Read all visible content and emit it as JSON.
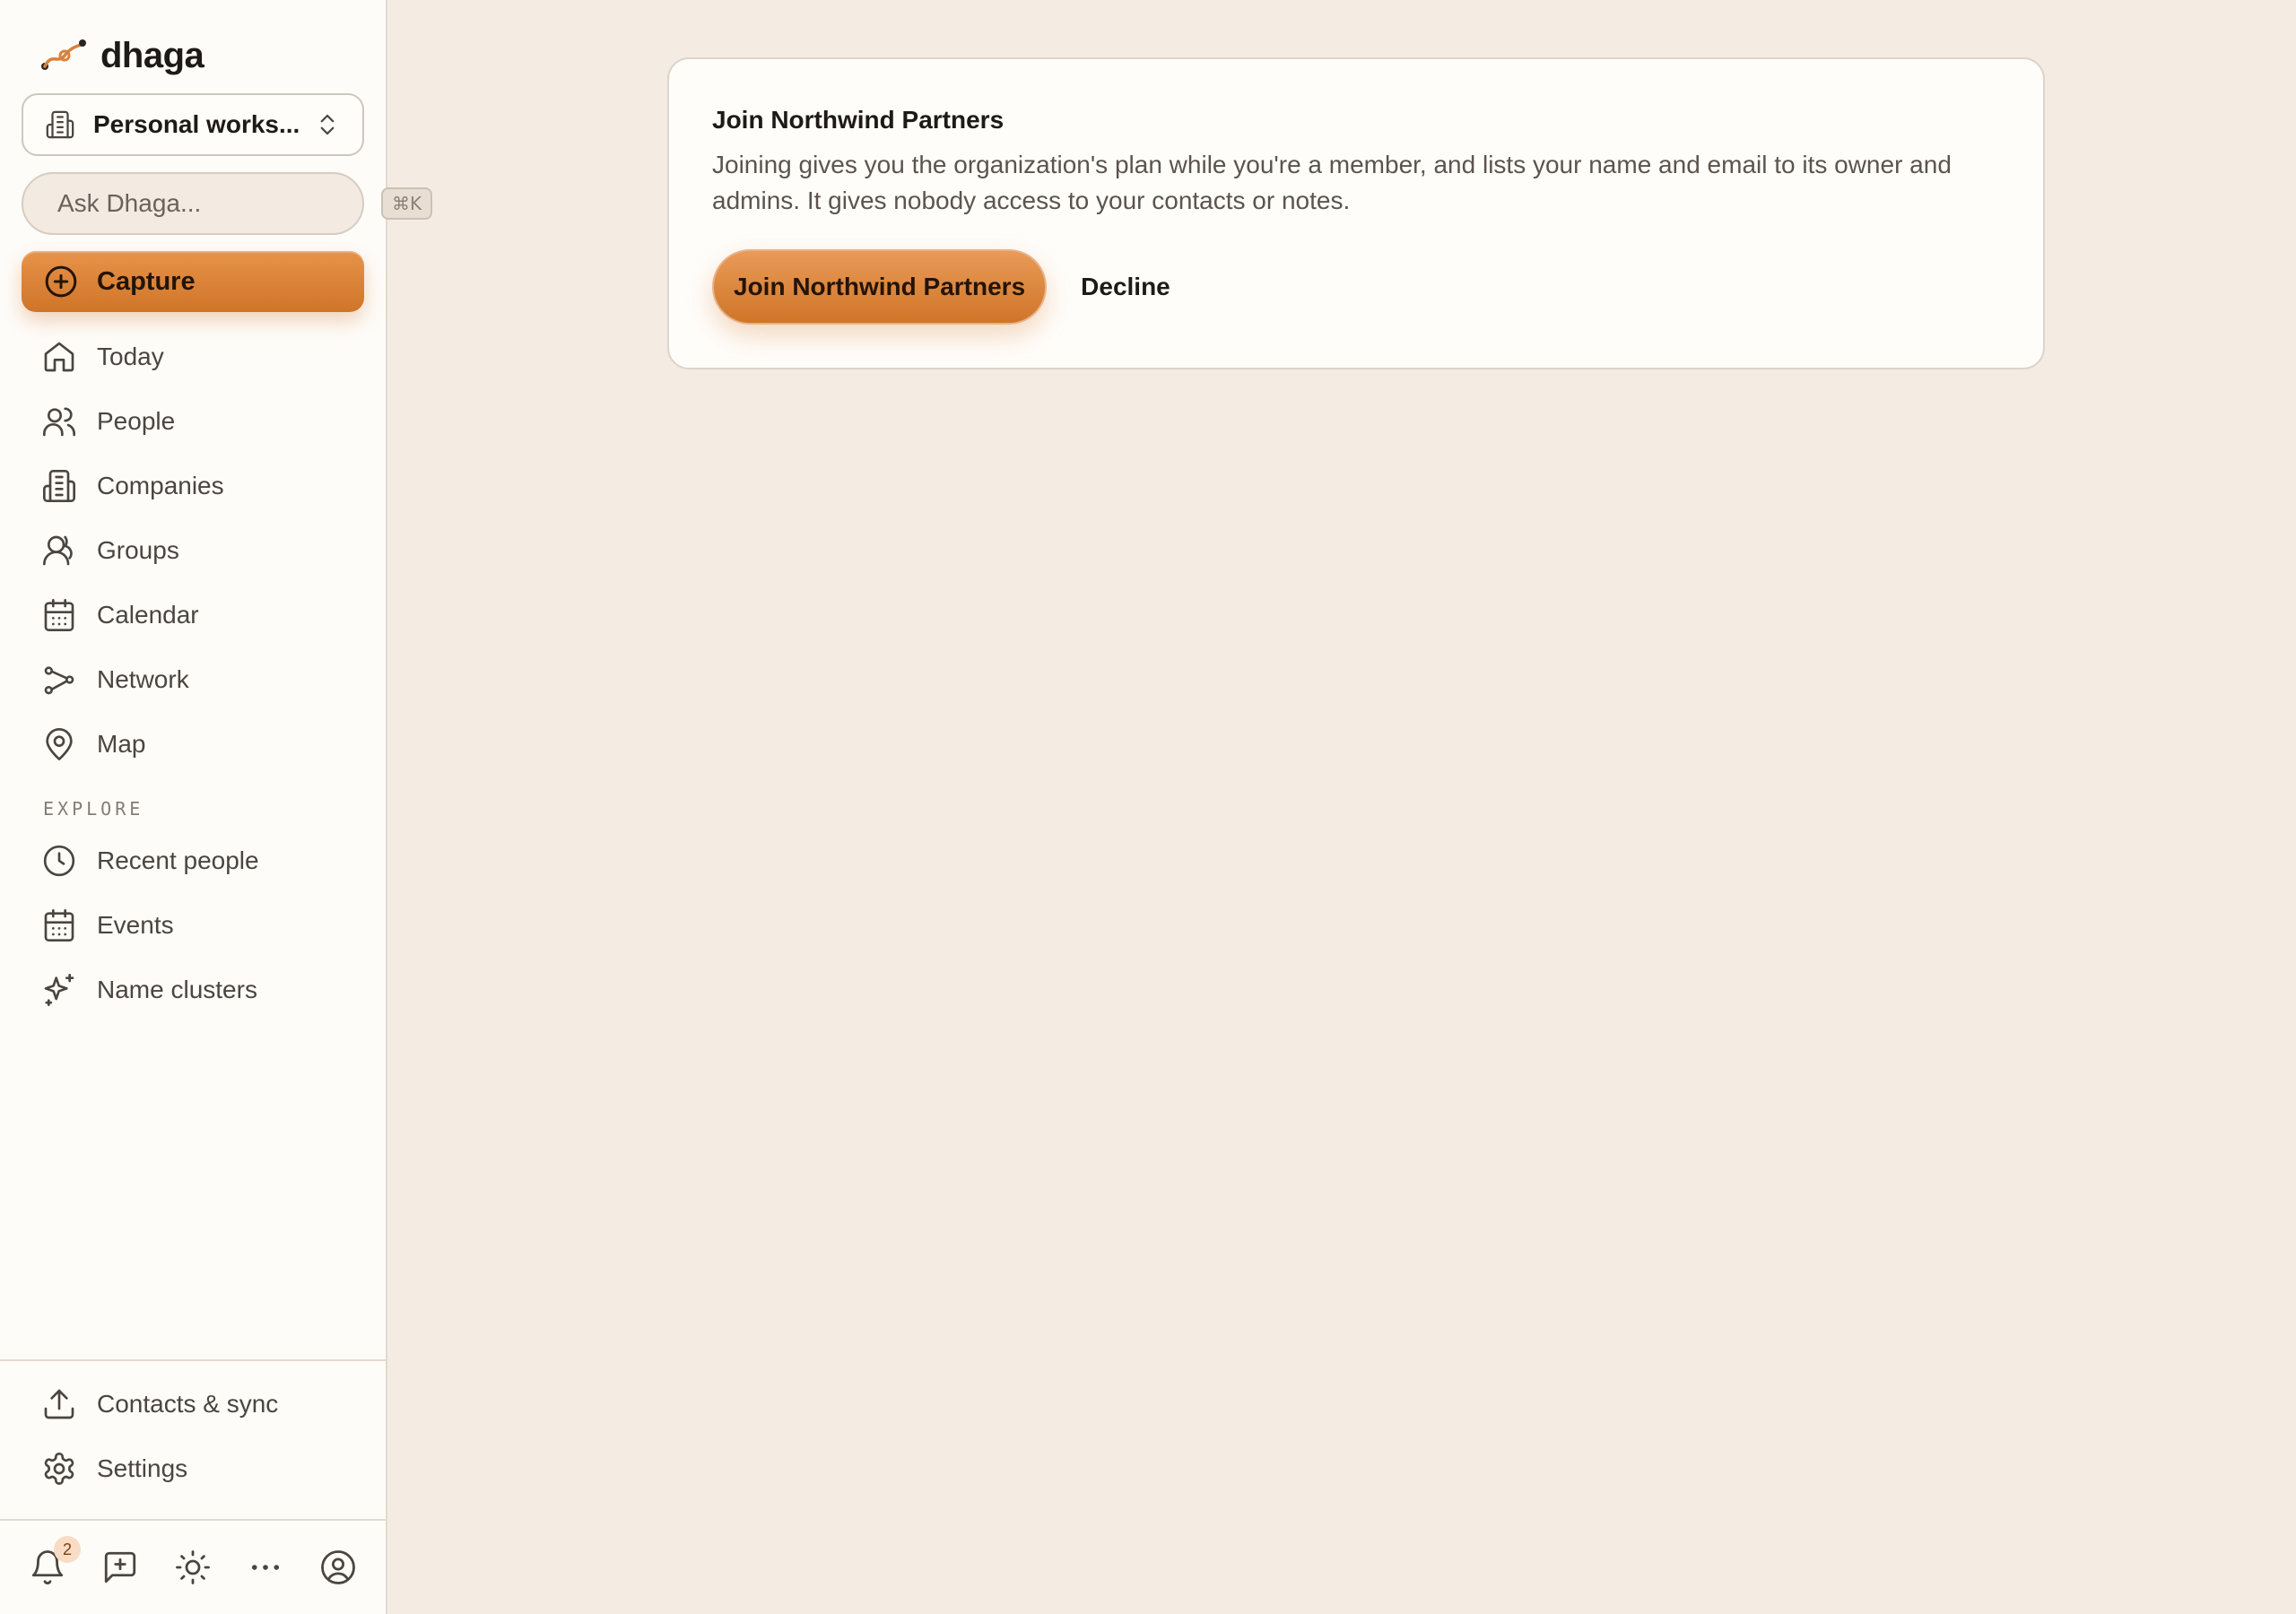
{
  "app": {
    "name": "dhaga"
  },
  "workspace": {
    "label": "Personal works..."
  },
  "search": {
    "placeholder": "Ask Dhaga...",
    "shortcut": "⌘K"
  },
  "capture": {
    "label": "Capture"
  },
  "nav": {
    "items": [
      {
        "label": "Today",
        "icon": "home-icon"
      },
      {
        "label": "People",
        "icon": "people-icon"
      },
      {
        "label": "Companies",
        "icon": "building-icon"
      },
      {
        "label": "Groups",
        "icon": "group-icon"
      },
      {
        "label": "Calendar",
        "icon": "calendar-icon"
      },
      {
        "label": "Network",
        "icon": "network-icon"
      },
      {
        "label": "Map",
        "icon": "map-pin-icon"
      }
    ]
  },
  "explore": {
    "section_label": "EXPLORE",
    "items": [
      {
        "label": "Recent people",
        "icon": "clock-icon"
      },
      {
        "label": "Events",
        "icon": "calendar-icon"
      },
      {
        "label": "Name clusters",
        "icon": "sparkles-icon"
      }
    ]
  },
  "bottom_nav": {
    "items": [
      {
        "label": "Contacts & sync",
        "icon": "upload-icon"
      },
      {
        "label": "Settings",
        "icon": "gear-icon"
      }
    ]
  },
  "footer": {
    "notification_count": "2"
  },
  "invite": {
    "title": "Join Northwind Partners",
    "description": "Joining gives you the organization's plan while you're a member, and lists your name and email to its owner and admins. It gives nobody access to your contacts or notes.",
    "accept_label": "Join Northwind Partners",
    "decline_label": "Decline"
  },
  "colors": {
    "accent": "#d9813a",
    "background": "#f4ece3",
    "sidebar": "#fefcf9"
  }
}
